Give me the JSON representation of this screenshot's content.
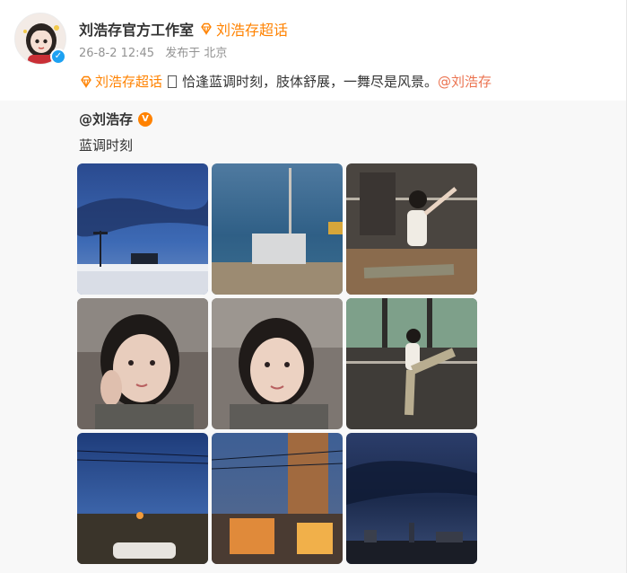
{
  "post": {
    "author": "刘浩存官方工作室",
    "topic": "刘浩存超话",
    "date": "26-8-2 12:45",
    "source": "发布于 北京",
    "text_topic": "刘浩存超话",
    "text_body": "恰逢蓝调时刻，肢体舒展，一舞尽是风景。",
    "mention": "@刘浩存"
  },
  "repost": {
    "author": "@刘浩存",
    "text": "蓝调时刻",
    "images": [
      {
        "name": "image-dusk-sky-streetlamp",
        "kind": "sky"
      },
      {
        "name": "image-dusk-tower",
        "kind": "sky"
      },
      {
        "name": "image-dance-studio-split",
        "kind": "dance"
      },
      {
        "name": "image-selfie-1",
        "kind": "portrait"
      },
      {
        "name": "image-selfie-2",
        "kind": "portrait"
      },
      {
        "name": "image-dance-barre-stretch",
        "kind": "dance"
      },
      {
        "name": "image-dusk-street-car",
        "kind": "sky"
      },
      {
        "name": "image-dusk-street-lights",
        "kind": "sky"
      },
      {
        "name": "image-dusk-cityscape",
        "kind": "sky"
      }
    ]
  },
  "colors": {
    "accent_orange": "#ff8200",
    "mention": "#eb7350",
    "verify_blue": "#1da1f2",
    "repost_bg": "#f8f8f8"
  }
}
